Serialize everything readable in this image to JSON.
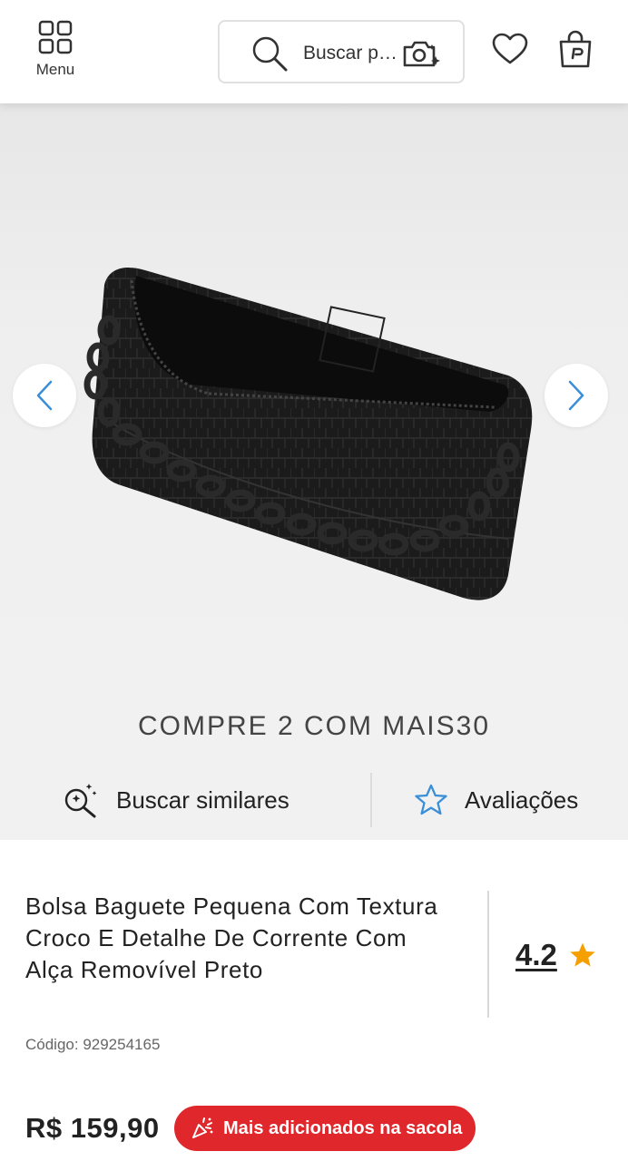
{
  "header": {
    "menu_label": "Menu",
    "search_placeholder": "Buscar produtos",
    "icons": [
      "grid-menu-icon",
      "search-icon",
      "camera-sparkle-icon",
      "heart-icon",
      "shopping-bag-icon"
    ]
  },
  "gallery": {
    "image_alt": "Bolsa baguete preta com textura croco e corrente",
    "prev_icon": "chevron-left-icon",
    "next_icon": "chevron-right-icon",
    "arrow_color": "#3a8fd8"
  },
  "promo": {
    "text": "COMPRE 2 COM MAIS30"
  },
  "actions": {
    "similar_label": "Buscar similares",
    "reviews_label": "Avaliações"
  },
  "product": {
    "title": "Bolsa Baguete Pequena Com Textura Croco E Detalhe De Corrente Com Alça Removível Preto",
    "rating": "4.2",
    "code": "Código: 929254165",
    "price": "R$ 159,90",
    "badge": "Mais adicionados na sacola"
  },
  "colors": {
    "badge_bg": "#e0272c",
    "star": "#f5a000",
    "review_star_outline": "#3a8fd8"
  }
}
